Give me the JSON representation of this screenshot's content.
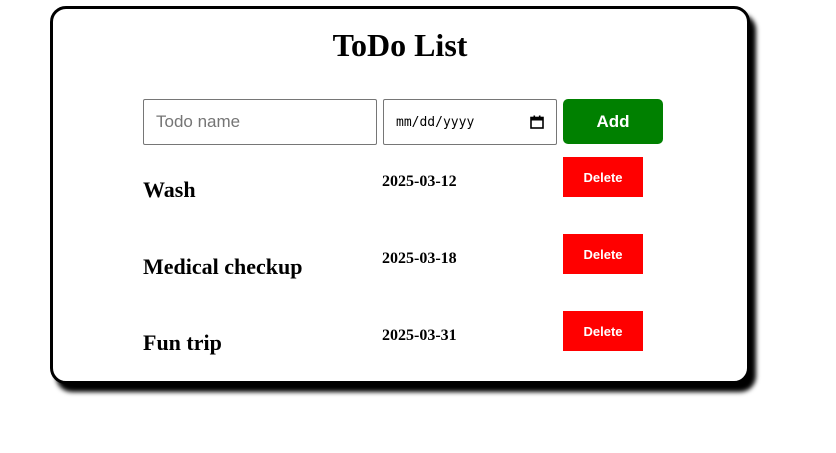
{
  "app": {
    "title": "ToDo List"
  },
  "form": {
    "name_placeholder": "Todo name",
    "date_placeholder": "mm/dd/yyyy",
    "add_label": "Add"
  },
  "todos": [
    {
      "name": "Wash",
      "date": "2025-03-12",
      "delete_label": "Delete"
    },
    {
      "name": "Medical checkup",
      "date": "2025-03-18",
      "delete_label": "Delete"
    },
    {
      "name": "Fun trip",
      "date": "2025-03-31",
      "delete_label": "Delete"
    }
  ],
  "colors": {
    "add_button": "#008000",
    "delete_button": "#ff0000",
    "card_border": "#000000"
  },
  "icons": {
    "date_picker": "calendar-icon"
  }
}
